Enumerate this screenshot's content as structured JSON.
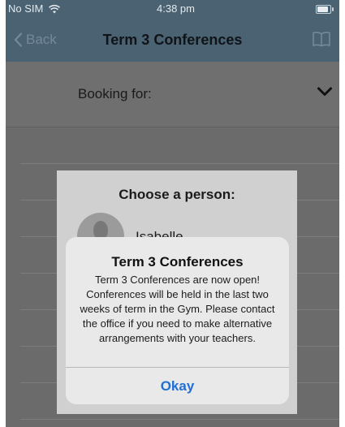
{
  "status_bar": {
    "carrier": "No SIM",
    "time": "4:38 pm"
  },
  "nav": {
    "back_label": "Back",
    "title": "Term 3 Conferences",
    "right_icon": "book-icon"
  },
  "booking": {
    "label": "Booking for:",
    "icon": "chevron-down-icon"
  },
  "chooser": {
    "title": "Choose a person:",
    "person_name": "Isabelle"
  },
  "alert": {
    "title": "Term 3 Conferences",
    "message": "Term 3 Conferences are now open! Conferences will be held in the last two weeks of term in the Gym. Please contact the office if you need to make alternative arrangements with your teachers.",
    "button_label": "Okay"
  },
  "colors": {
    "nav_bar": "#4a6271",
    "dim_overlay": "#6b6b6b",
    "alert_button": "#1f6fd6"
  }
}
